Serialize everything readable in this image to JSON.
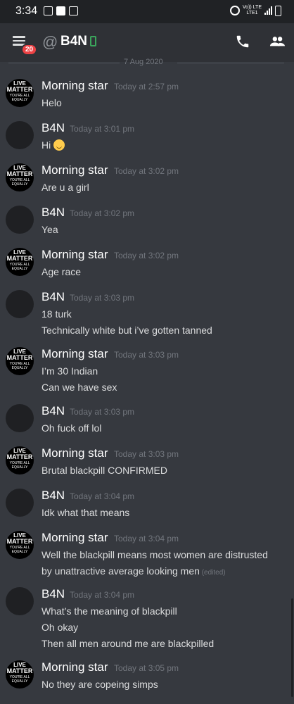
{
  "status": {
    "time": "3:34",
    "network": "Vo)) LTE",
    "network2": "LTE1"
  },
  "header": {
    "unread_count": "20",
    "channel_title": "B4N"
  },
  "date_divider": "7 Aug 2020",
  "messages": [
    {
      "author": "Morning star",
      "time": "Today at 2:57 pm",
      "lines": [
        "Helo"
      ]
    },
    {
      "author": "B4N",
      "time": "Today at 3:01 pm",
      "lines": [
        "Hi"
      ]
    },
    {
      "author": "Morning star",
      "time": "Today at 3:02 pm",
      "lines": [
        "Are u a girl"
      ]
    },
    {
      "author": "B4N",
      "time": "Today at 3:02 pm",
      "lines": [
        "Yea"
      ]
    },
    {
      "author": "Morning star",
      "time": "Today at 3:02 pm",
      "lines": [
        "Age race"
      ]
    },
    {
      "author": "B4N",
      "time": "Today at 3:03 pm",
      "lines": [
        "18 turk",
        "Technically white but i’ve gotten tanned"
      ]
    },
    {
      "author": "Morning star",
      "time": "Today at 3:03 pm",
      "lines": [
        "I’m  30 Indian",
        "Can we have sex"
      ]
    },
    {
      "author": "B4N",
      "time": "Today at 3:03 pm",
      "lines": [
        "Oh fuck off lol"
      ]
    },
    {
      "author": "Morning star",
      "time": "Today at 3:03 pm",
      "lines": [
        "Brutal blackpill CONFIRMED"
      ]
    },
    {
      "author": "B4N",
      "time": "Today at 3:04 pm",
      "lines": [
        "Idk what that means"
      ]
    },
    {
      "author": "Morning star",
      "time": "Today at 3:04 pm",
      "lines": [
        "Well the blackpill means  most women are distrusted",
        "by unattractive average looking men"
      ],
      "edited": "(edited)"
    },
    {
      "author": "B4N",
      "time": "Today at 3:04 pm",
      "lines": [
        "What’s the meaning of blackpill",
        "Oh okay",
        "Then all men around me are blackpilled"
      ]
    },
    {
      "author": "Morning star",
      "time": "Today at 3:05 pm",
      "lines": [
        "No they are copeing simps"
      ]
    }
  ],
  "avatar_ms": {
    "l1": "LIVE",
    "l2": "MATTER",
    "l3": "YOU'RE ALL EQUALLY"
  },
  "icons": {
    "menu": "hamburger-menu-icon",
    "at": "at-sign-icon",
    "mobile": "mobile-phone-icon",
    "call": "phone-call-icon",
    "members": "members-icon",
    "emoji": "slightly-smiling-face-emoji"
  },
  "colors": {
    "background": "#36393f",
    "header": "#2f3136",
    "badge": "#ed4245",
    "online": "#3ba55c"
  }
}
